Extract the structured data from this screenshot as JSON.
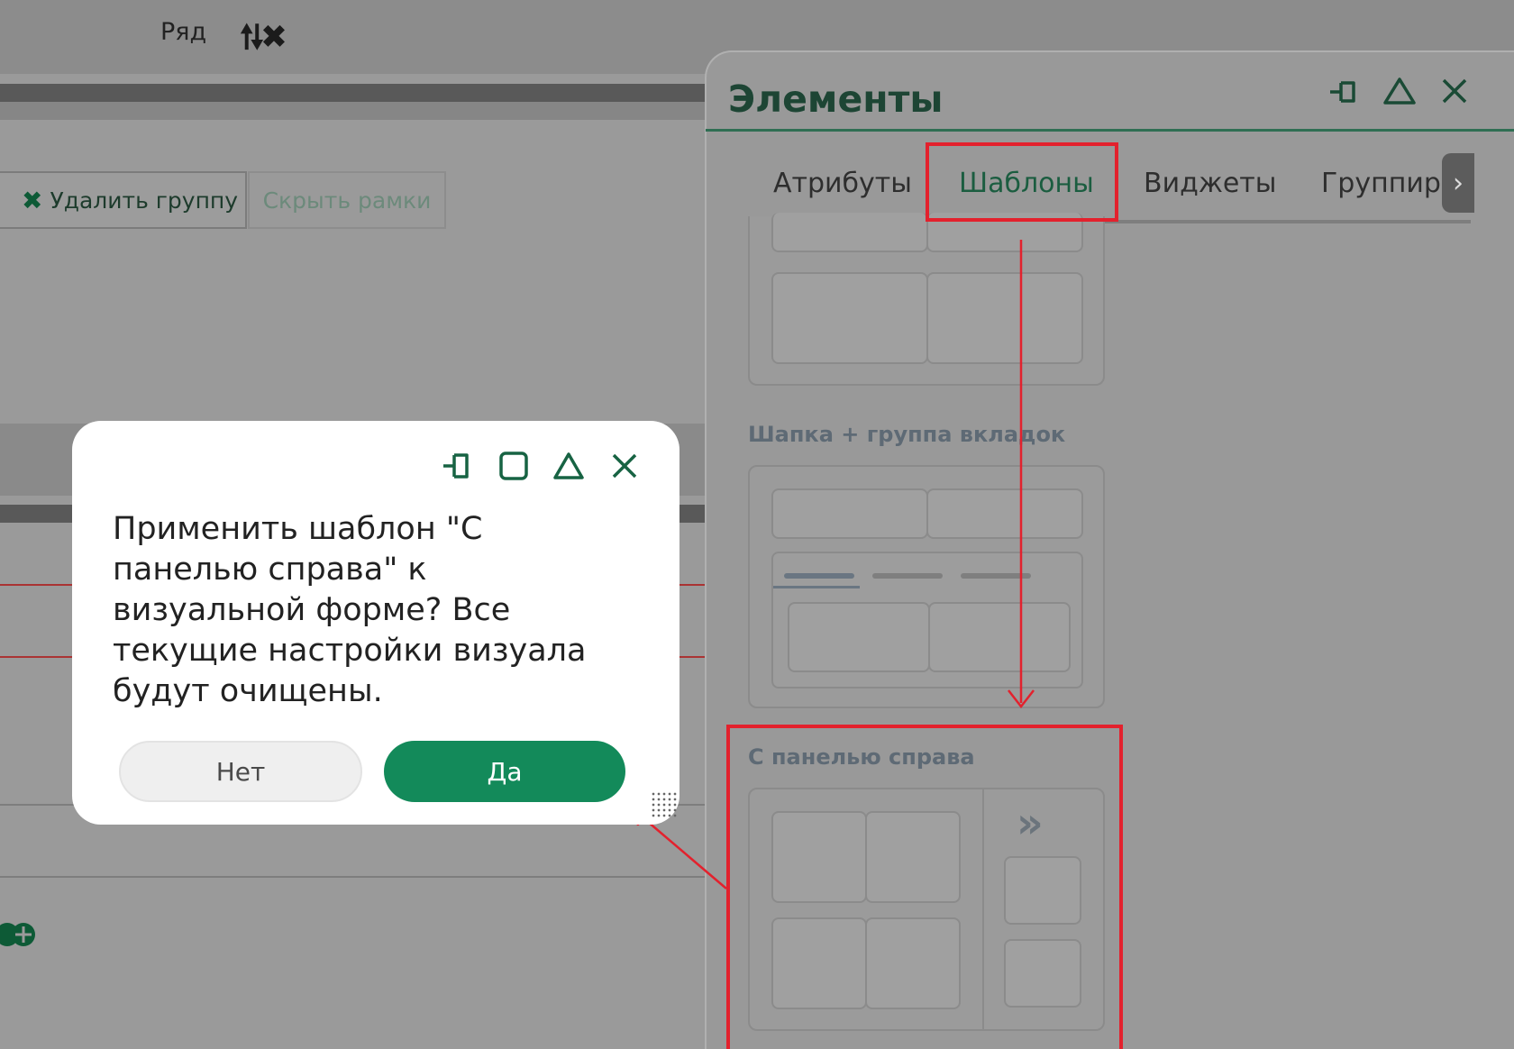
{
  "toolbar": {
    "row_label": "Ряд",
    "row_icons": "🠕🠗✖"
  },
  "groupbar": {
    "delete_label": "Удалить группу",
    "delete_icon": "✖",
    "hide_label": "Скрыть рамки"
  },
  "panel": {
    "title": "Элементы",
    "controls": {
      "pin": "⊣▯",
      "collapse": "△",
      "close": "✕"
    },
    "tabs": [
      {
        "label": "Атрибуты"
      },
      {
        "label": "Шаблоны"
      },
      {
        "label": "Виджеты"
      },
      {
        "label": "Группиро"
      }
    ],
    "tab_scroll": "›",
    "templates": [
      {
        "label": "Шапка + группа вкладок"
      },
      {
        "label": "С панелью справа"
      }
    ],
    "right_panel_icon": "»"
  },
  "dialog": {
    "message": "Применить шаблон \"С панелью справа\" к визуальной форме? Все текущие настройки визуала будут очищены.",
    "no_label": "Нет",
    "yes_label": "Да",
    "controls": {
      "pin": "⊣▯",
      "maximize": "▢",
      "collapse": "△",
      "close": "✕"
    }
  },
  "colors": {
    "accent": "#138a5a",
    "highlight": "#e3212d"
  }
}
